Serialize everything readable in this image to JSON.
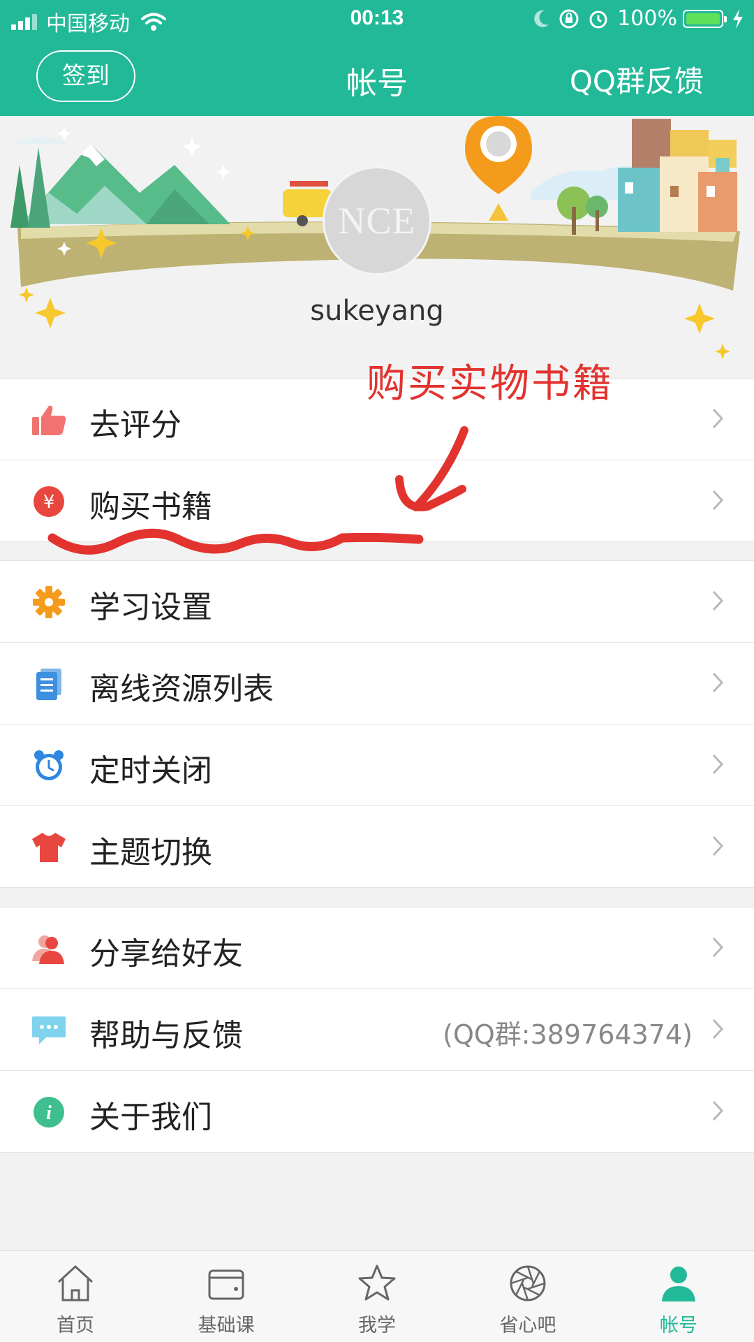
{
  "status_bar": {
    "carrier": "中国移动",
    "time": "00:13",
    "battery": "100%",
    "battery_level": 1.0,
    "icons": [
      "signal-icon",
      "wifi-icon",
      "moon-icon",
      "rotation-lock-icon",
      "alarm-icon",
      "battery-icon",
      "charging-icon"
    ]
  },
  "nav": {
    "checkin_label": "签到",
    "title": "帐号",
    "qq_feedback_label": "QQ群反馈"
  },
  "profile": {
    "avatar_text": "NCE",
    "username": "sukeyang"
  },
  "annotation": {
    "text": "购买实物书籍"
  },
  "menu_groups": [
    {
      "items": [
        {
          "label": "去评分",
          "icon": "thumbs-up-icon"
        },
        {
          "label": "购买书籍",
          "icon": "yuan-icon"
        }
      ]
    },
    {
      "items": [
        {
          "label": "学习设置",
          "icon": "gear-icon"
        },
        {
          "label": "离线资源列表",
          "icon": "document-list-icon"
        },
        {
          "label": "定时关闭",
          "icon": "alarm-clock-icon"
        },
        {
          "label": "主题切换",
          "icon": "tshirt-icon"
        }
      ]
    },
    {
      "items": [
        {
          "label": "分享给好友",
          "icon": "user-share-icon"
        },
        {
          "label": "帮助与反馈",
          "icon": "chat-bubble-icon",
          "note": "(QQ群:389764374)"
        },
        {
          "label": "关于我们",
          "icon": "info-icon"
        }
      ]
    }
  ],
  "tabs": [
    {
      "label": "首页",
      "icon": "home-icon"
    },
    {
      "label": "基础课",
      "icon": "wallet-icon"
    },
    {
      "label": "我学",
      "icon": "star-icon"
    },
    {
      "label": "省心吧",
      "icon": "aperture-icon"
    },
    {
      "label": "帐号",
      "icon": "user-icon",
      "active": true
    }
  ],
  "colors": {
    "brand": "#22b998",
    "annotation": "#e2332f",
    "active_tab": "#22b998"
  }
}
